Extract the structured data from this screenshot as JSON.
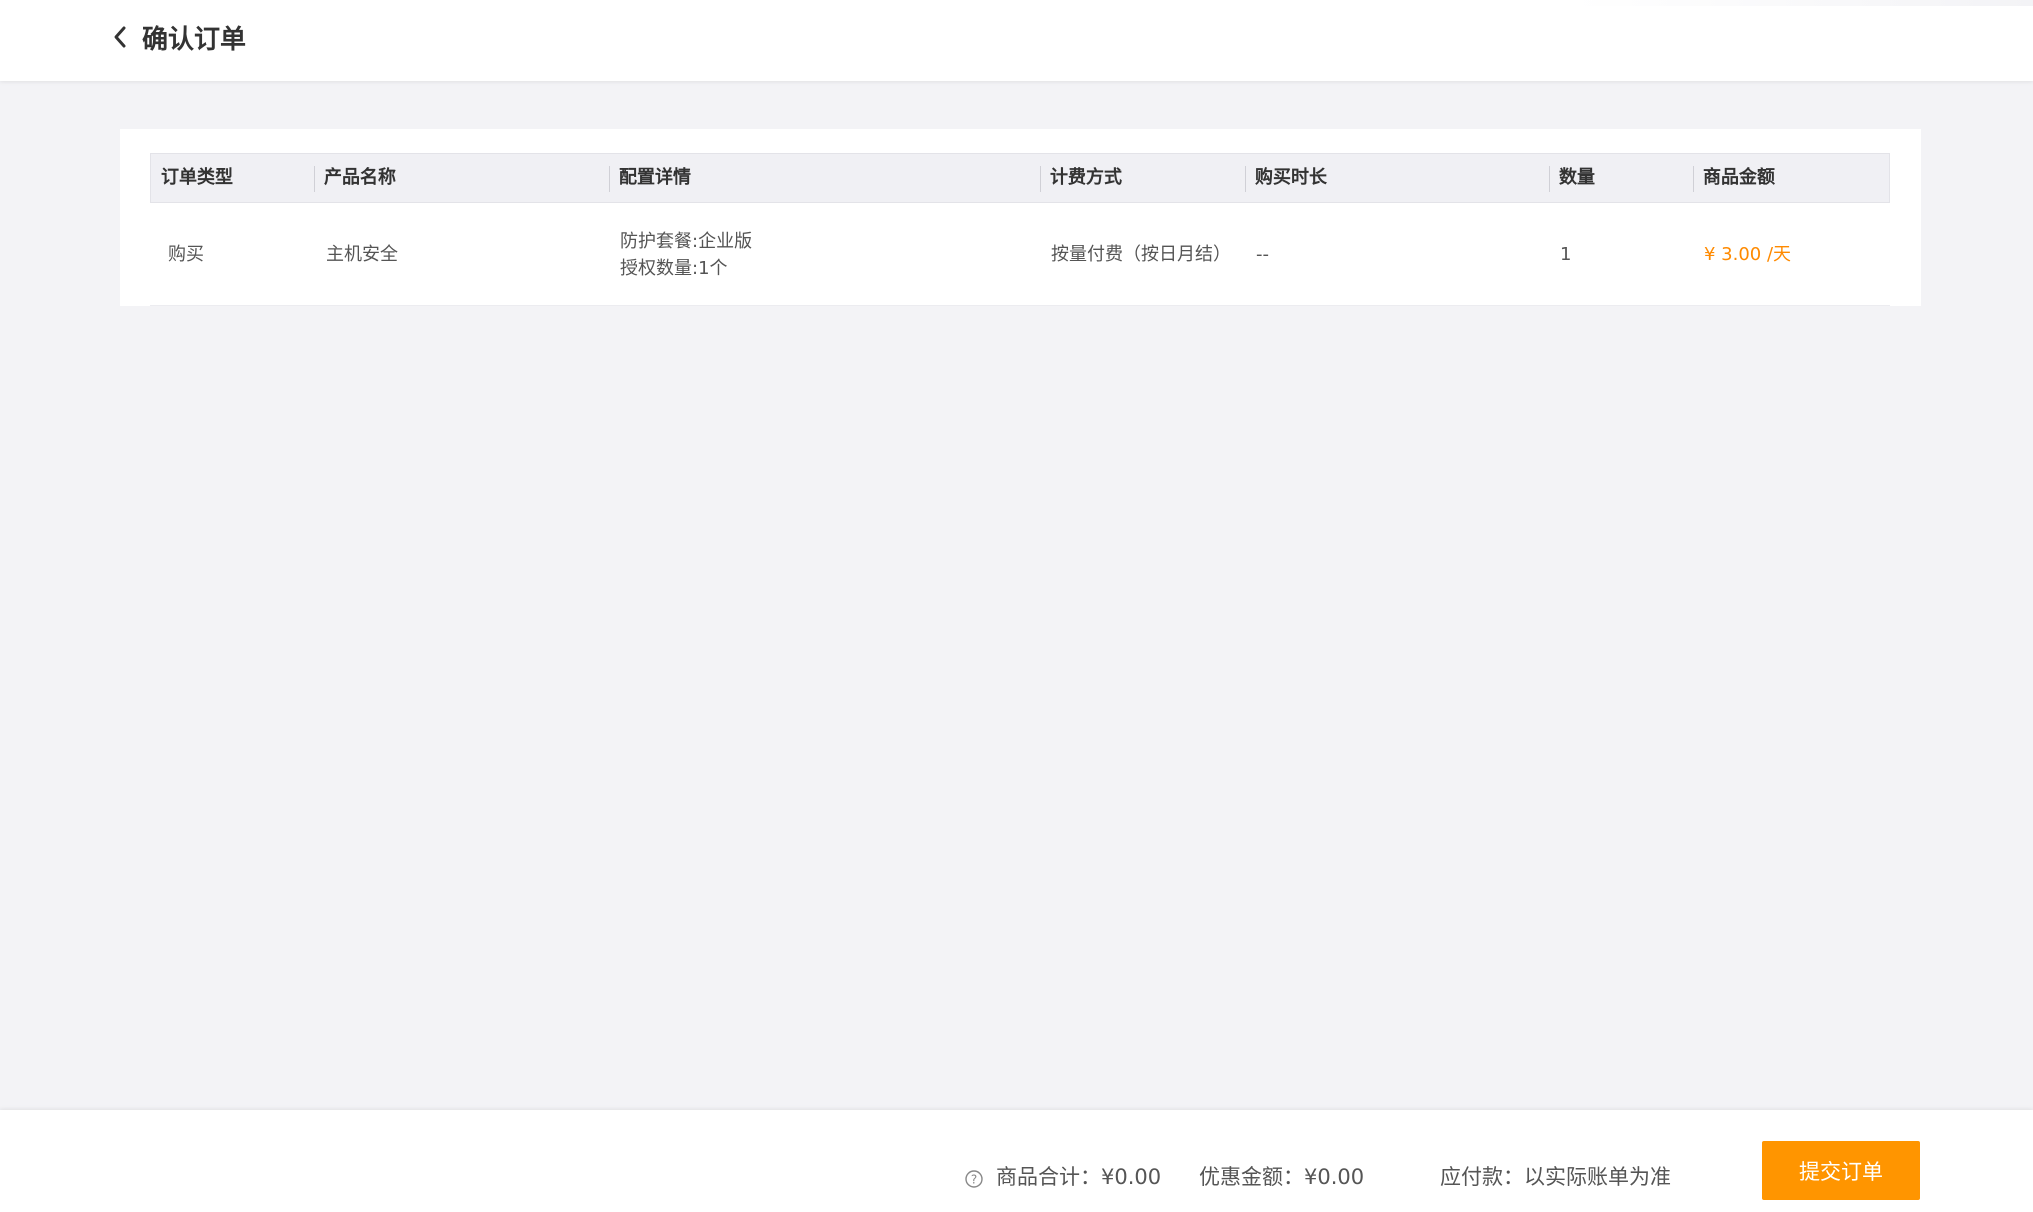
{
  "header": {
    "title": "确认订单"
  },
  "table": {
    "columns": [
      "订单类型",
      "产品名称",
      "配置详情",
      "计费方式",
      "购买时长",
      "数量",
      "商品金额"
    ],
    "rows": [
      {
        "order_type": "购买",
        "product_name": "主机安全",
        "config_line1": "防护套餐:企业版",
        "config_line2": "授权数量:1个",
        "billing": "按量付费（按日月结）",
        "duration": "--",
        "quantity": "1",
        "amount": "¥ 3.00 /天"
      }
    ]
  },
  "footer": {
    "subtotal": "商品合计：¥0.00",
    "discount": "优惠金额：¥0.00",
    "payable": "应付款：以实际账单为准",
    "submit_label": "提交订单"
  },
  "colors": {
    "accent": "#ff9500",
    "price": "#ff8a00",
    "background": "#f3f3f6"
  },
  "icons": {
    "back": "chevron-left-icon",
    "help": "question-circle-icon"
  }
}
